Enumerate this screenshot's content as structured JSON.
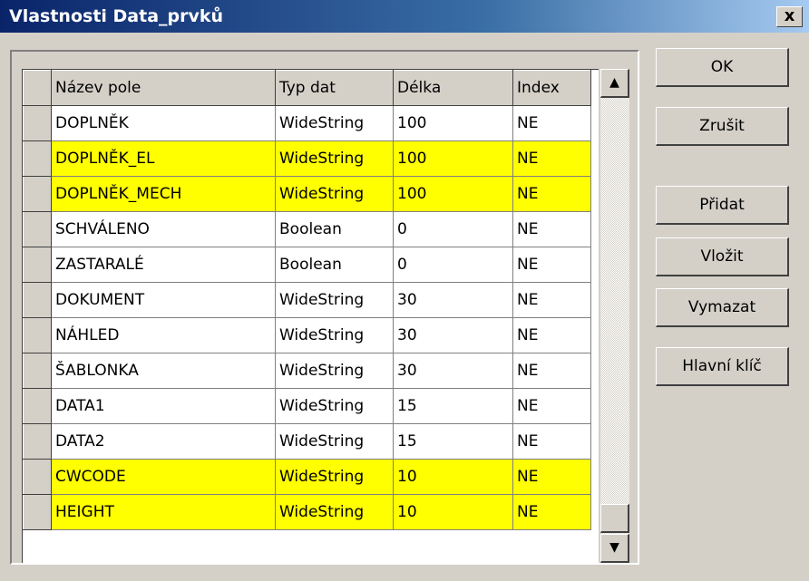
{
  "window": {
    "title": "Vlastnosti Data_prvků",
    "close_label": "x"
  },
  "grid": {
    "columns": [
      "Název pole",
      "Typ dat",
      "Délka",
      "Index"
    ],
    "rows": [
      {
        "name": "DOPLNĚK",
        "type": "WideString",
        "length": "100",
        "index": "NE",
        "highlight": false
      },
      {
        "name": "DOPLNĚK_EL",
        "type": "WideString",
        "length": "100",
        "index": "NE",
        "highlight": true
      },
      {
        "name": "DOPLNĚK_MECH",
        "type": "WideString",
        "length": "100",
        "index": "NE",
        "highlight": true
      },
      {
        "name": "SCHVÁLENO",
        "type": "Boolean",
        "length": "0",
        "index": "NE",
        "highlight": false
      },
      {
        "name": "ZASTARALÉ",
        "type": "Boolean",
        "length": "0",
        "index": "NE",
        "highlight": false
      },
      {
        "name": "DOKUMENT",
        "type": "WideString",
        "length": "30",
        "index": "NE",
        "highlight": false
      },
      {
        "name": "NÁHLED",
        "type": "WideString",
        "length": "30",
        "index": "NE",
        "highlight": false
      },
      {
        "name": "ŠABLONKA",
        "type": "WideString",
        "length": "30",
        "index": "NE",
        "highlight": false
      },
      {
        "name": "DATA1",
        "type": "WideString",
        "length": "15",
        "index": "NE",
        "highlight": false
      },
      {
        "name": "DATA2",
        "type": "WideString",
        "length": "15",
        "index": "NE",
        "highlight": false
      },
      {
        "name": "CWCODE",
        "type": "WideString",
        "length": "10",
        "index": "NE",
        "highlight": true
      },
      {
        "name": "HEIGHT",
        "type": "WideString",
        "length": "10",
        "index": "NE",
        "highlight": true
      }
    ],
    "highlight_color": "#ffff00"
  },
  "scrollbar": {
    "up_icon": "▲",
    "down_icon": "▼"
  },
  "buttons": {
    "ok": "OK",
    "cancel": "Zrušit",
    "add": "Přidat",
    "insert": "Vložit",
    "delete": "Vymazat",
    "primary_key": "Hlavní klíč"
  }
}
